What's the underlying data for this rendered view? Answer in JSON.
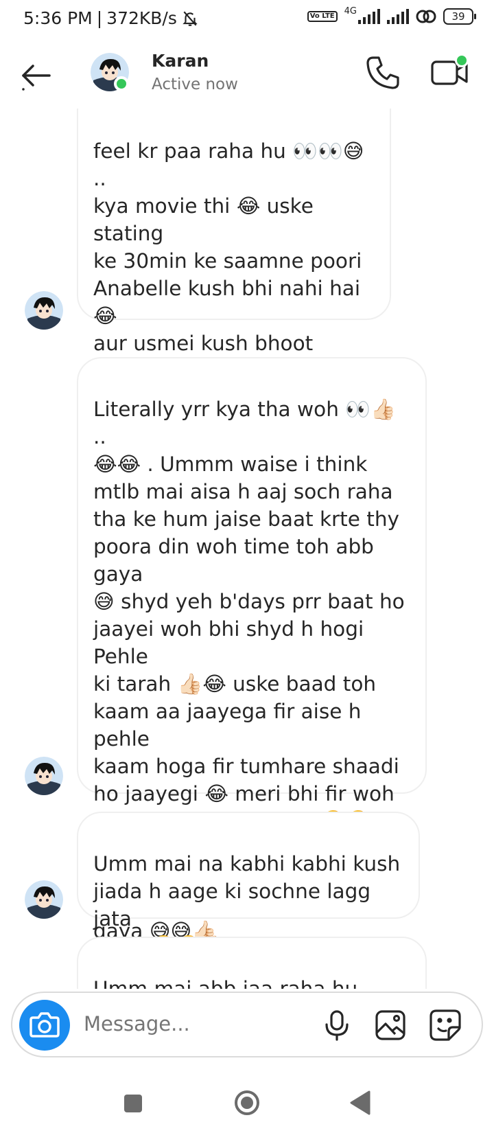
{
  "status_bar": {
    "time": "5:36 PM",
    "separator": "|",
    "speed": "372KB/s",
    "network_label": "4G",
    "volte": "Vo LTE",
    "battery": "39"
  },
  "header": {
    "contact_name": "Karan",
    "contact_status": "Active now",
    "online_color": "#35c759"
  },
  "messages": [
    {
      "text": "feel kr paa raha hu 👀👀😅 ..\nkya movie thi 😂 uske stating\nke 30min ke saamne poori\nAnabelle kush bhi nahi hai 😂\naur usmei kush bhoot wagaira\nkush tha bhi nahi 😅😂 mai\njiada batauga nahi warna story\nkharab ho jaayegi 👍🏻😁😅 .."
    },
    {
      "text": "Literally yrr kya tha woh 👀👍🏻 ..\n😂😂 . Ummm waise i think\nmtlb mai aisa h aaj soch raha\ntha ke hum jaise baat krte thy\npoora din woh time toh abb gaya\n😅 shyd yeh b'days prr baat ho\njaayei woh bhi shyd h hogi Pehle\nki tarah 👍🏻😂 uske baad toh\nkaam aa jaayega fir aise h pehle\nkaam hoga fir tumhare shaadi\nho jaayegi 😂 meri bhi fir woh\nsbb fir bass kush nahi 🤣🤣\nmtlb yeh hai mera ke aise poora\ndin baad krne wala time chala\ngaya  😅😅👍🏻"
    },
    {
      "text": "Umm mai na kabhi kabhi kush\njiada h aage ki sochne lagg jata\nhu 👀🤣🤣👍🏻😅"
    },
    {
      "text": "Umm mai abb jaa raha hu sone\n😅😂 byeeeeeeeeeyyy chudel"
    }
  ],
  "composer": {
    "placeholder": "Message...",
    "accent": "#1a8cf0"
  },
  "icons": {
    "back": "arrow-left-icon",
    "call": "phone-icon",
    "video": "video-call-icon",
    "camera": "camera-icon",
    "mic": "microphone-icon",
    "gallery": "image-icon",
    "sticker": "sticker-icon"
  }
}
